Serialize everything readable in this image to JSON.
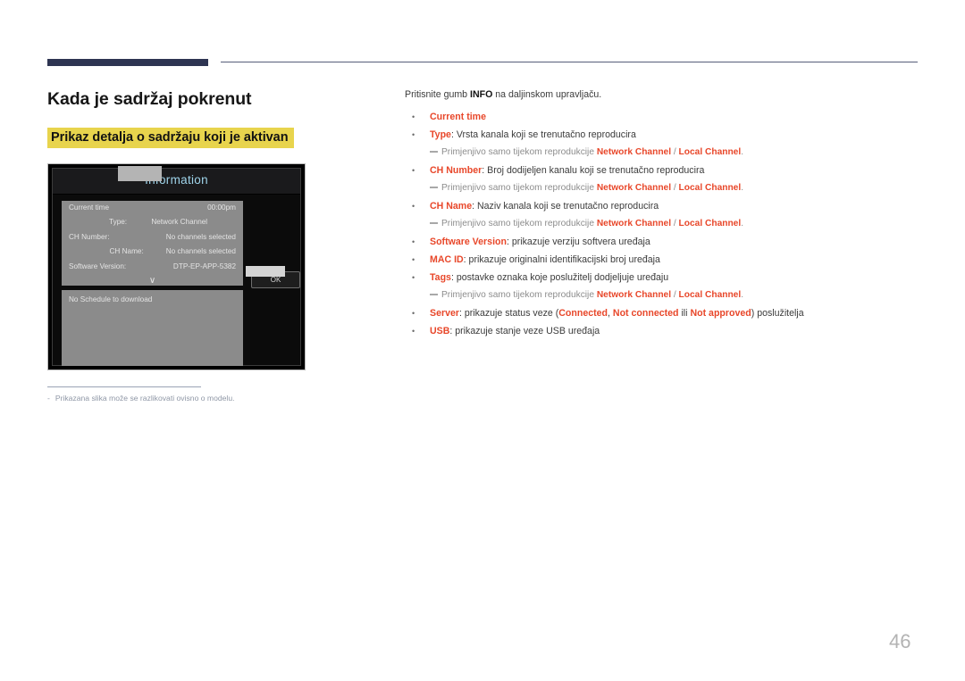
{
  "page": {
    "title": "Kada je sadržaj pokrenut",
    "subheading": "Prikaz detalja o sadržaju koji je aktivan",
    "number": "46",
    "accent_color": "#e8472a",
    "highlight_color": "#e8d44d",
    "navy_color": "#2e3552"
  },
  "figure": {
    "panel_title": "Information",
    "rows": [
      {
        "key": "Current time",
        "value": "00:00pm"
      },
      {
        "key": "Type:",
        "value": "Network Channel"
      },
      {
        "key": "CH Number:",
        "value": "No channels selected"
      },
      {
        "key": "CH Name:",
        "value": "No channels selected"
      },
      {
        "key": "Software Version:",
        "value": "DTP-EP-APP-5382"
      }
    ],
    "chevron": "∨",
    "schedule_text": "No Schedule to download",
    "ok_button": "OK",
    "footnote_dash": "-",
    "footnote": "Prikazana slika može se razlikovati ovisno o modelu."
  },
  "content": {
    "lead_before": "Pritisnite gumb ",
    "lead_bold": "INFO",
    "lead_after": " na daljinskom upravljaču.",
    "subnote_prefix": "Primjenjivo samo tijekom reprodukcije ",
    "subnote_channel_a": "Network Channel",
    "subnote_separator": " / ",
    "subnote_channel_b": "Local Channel",
    "subnote_suffix": ".",
    "items": [
      {
        "term": "Current time",
        "desc": ""
      },
      {
        "term": "Type",
        "desc": ": Vrsta kanala koji se trenutačno reproducira",
        "note": true
      },
      {
        "term": "CH Number",
        "desc": ": Broj dodijeljen kanalu koji se trenutačno reproducira",
        "note": true
      },
      {
        "term": "CH Name",
        "desc": ": Naziv kanala koji se trenutačno reproducira",
        "note": true
      },
      {
        "term": "Software Version",
        "desc": ": prikazuje verziju softvera uređaja"
      },
      {
        "term": "MAC ID",
        "desc": ": prikazuje originalni identifikacijski broj uređaja"
      },
      {
        "term": "Tags",
        "desc": ": postavke oznaka koje poslužitelj dodjeljuje uređaju",
        "note": true
      }
    ],
    "server": {
      "term": "Server",
      "part1": ": prikazuje status veze (",
      "state1": "Connected",
      "part2": ", ",
      "state2": "Not connected",
      "part3": " ili ",
      "state3": "Not approved",
      "part4": ") poslužitelja"
    },
    "usb": {
      "term": "USB",
      "desc": ": prikazuje stanje veze USB uređaja"
    }
  }
}
